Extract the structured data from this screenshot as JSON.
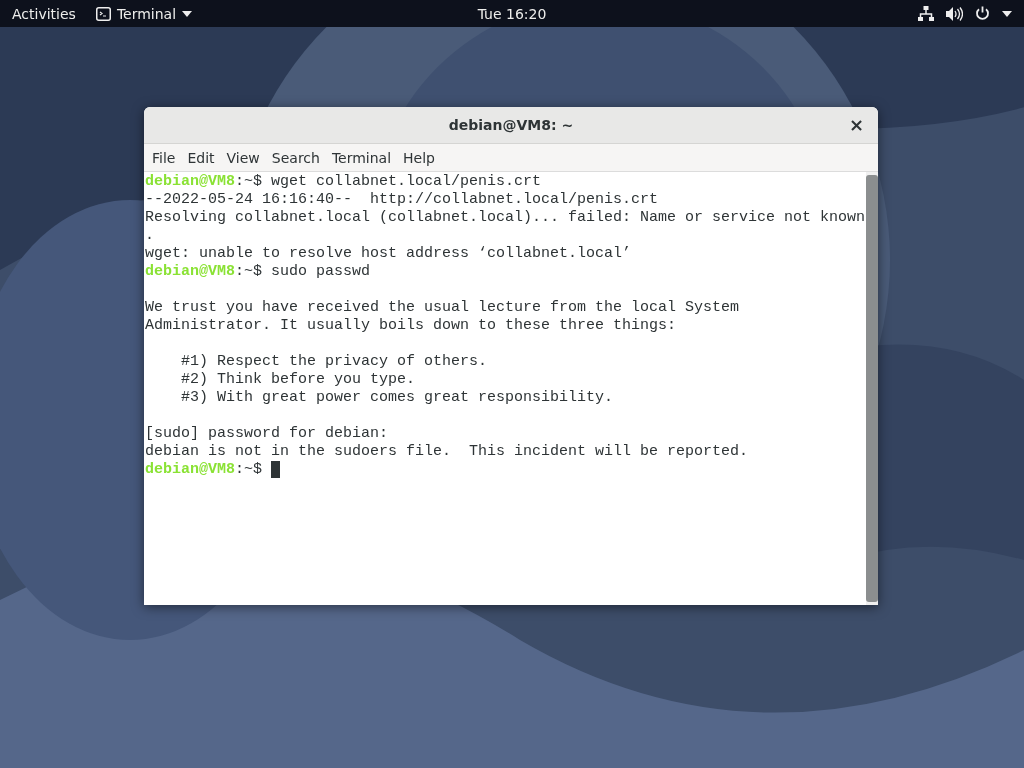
{
  "top_bar": {
    "activities": "Activities",
    "app_menu": "Terminal",
    "clock": "Tue 16:20"
  },
  "window": {
    "title": "debian@VM8: ~",
    "close": "×",
    "menu": [
      "File",
      "Edit",
      "View",
      "Search",
      "Terminal",
      "Help"
    ],
    "lines": [
      {
        "kind": "prompt",
        "prompt": "debian@VM8",
        "path": ":~$ ",
        "command": "wget collabnet.local/penis.crt"
      },
      {
        "kind": "output",
        "text": "--2022-05-24 16:16:40--  http://collabnet.local/penis.crt"
      },
      {
        "kind": "output",
        "text": "Resolving collabnet.local (collabnet.local)... failed: Name or service not known"
      },
      {
        "kind": "output",
        "text": "."
      },
      {
        "kind": "output",
        "text": "wget: unable to resolve host address ‘collabnet.local’"
      },
      {
        "kind": "prompt",
        "prompt": "debian@VM8",
        "path": ":~$ ",
        "command": "sudo passwd"
      },
      {
        "kind": "blank"
      },
      {
        "kind": "output",
        "text": "We trust you have received the usual lecture from the local System"
      },
      {
        "kind": "output",
        "text": "Administrator. It usually boils down to these three things:"
      },
      {
        "kind": "blank"
      },
      {
        "kind": "output",
        "text": "    #1) Respect the privacy of others."
      },
      {
        "kind": "output",
        "text": "    #2) Think before you type."
      },
      {
        "kind": "output",
        "text": "    #3) With great power comes great responsibility."
      },
      {
        "kind": "blank"
      },
      {
        "kind": "output",
        "text": "[sudo] password for debian:"
      },
      {
        "kind": "output",
        "text": "debian is not in the sudoers file.  This incident will be reported."
      },
      {
        "kind": "prompt",
        "prompt": "debian@VM8",
        "path": ":~$ "
      }
    ]
  }
}
